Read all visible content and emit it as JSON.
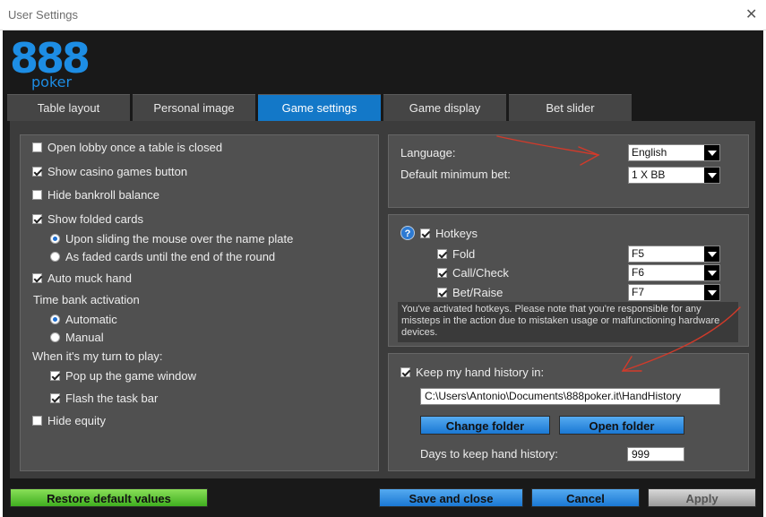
{
  "window": {
    "title": "User Settings",
    "close_glyph": "✕"
  },
  "logo": {
    "digits": "888",
    "word": "poker",
    "color": "#1d8de4"
  },
  "tabs": [
    {
      "label": "Table layout",
      "active": false
    },
    {
      "label": "Personal image",
      "active": false
    },
    {
      "label": "Game settings",
      "active": true
    },
    {
      "label": "Game display",
      "active": false
    },
    {
      "label": "Bet slider",
      "active": false
    }
  ],
  "left": {
    "open_lobby": {
      "label": "Open lobby once a table is closed",
      "checked": false
    },
    "show_casino": {
      "label": "Show casino games button",
      "checked": true
    },
    "hide_bankroll": {
      "label": "Hide bankroll balance",
      "checked": false
    },
    "show_folded": {
      "label": "Show folded cards",
      "checked": true
    },
    "folded_opt1": {
      "label": "Upon sliding the mouse over the name plate",
      "selected": true
    },
    "folded_opt2": {
      "label": "As faded cards until the end of the round",
      "selected": false
    },
    "auto_muck": {
      "label": "Auto muck hand",
      "checked": true
    },
    "time_bank_label": "Time bank activation",
    "time_bank_auto": {
      "label": "Automatic",
      "selected": true
    },
    "time_bank_manual": {
      "label": "Manual",
      "selected": false
    },
    "my_turn_label": "When it's my turn to play:",
    "popup_window": {
      "label": "Pop up the game window",
      "checked": true
    },
    "flash_taskbar": {
      "label": "Flash the task bar",
      "checked": true
    },
    "hide_equity": {
      "label": "Hide equity",
      "checked": false
    }
  },
  "language": {
    "label": "Language:",
    "value": "English",
    "min_bet_label": "Default minimum bet:",
    "min_bet_value": "1 X BB"
  },
  "hotkeys": {
    "help_glyph": "?",
    "label": "Hotkeys",
    "checked": true,
    "fold": {
      "label": "Fold",
      "key": "F5",
      "checked": true
    },
    "call": {
      "label": "Call/Check",
      "key": "F6",
      "checked": true
    },
    "bet": {
      "label": "Bet/Raise",
      "key": "F7",
      "checked": true
    },
    "warning": "You've activated hotkeys. Please note that you're responsible for any missteps in the action due to mistaken usage or malfunctioning hardware devices."
  },
  "history": {
    "label": "Keep my hand history in:",
    "checked": true,
    "path": "C:\\Users\\Antonio\\Documents\\888poker.it\\HandHistory",
    "change_folder": "Change folder",
    "open_folder": "Open folder",
    "days_label": "Days to keep hand history:",
    "days_value": "999"
  },
  "footer": {
    "restore": "Restore default values",
    "save_close": "Save and close",
    "cancel": "Cancel",
    "apply": "Apply"
  },
  "colors": {
    "accent": "#1378c8",
    "annotation": "#d23a2a"
  }
}
